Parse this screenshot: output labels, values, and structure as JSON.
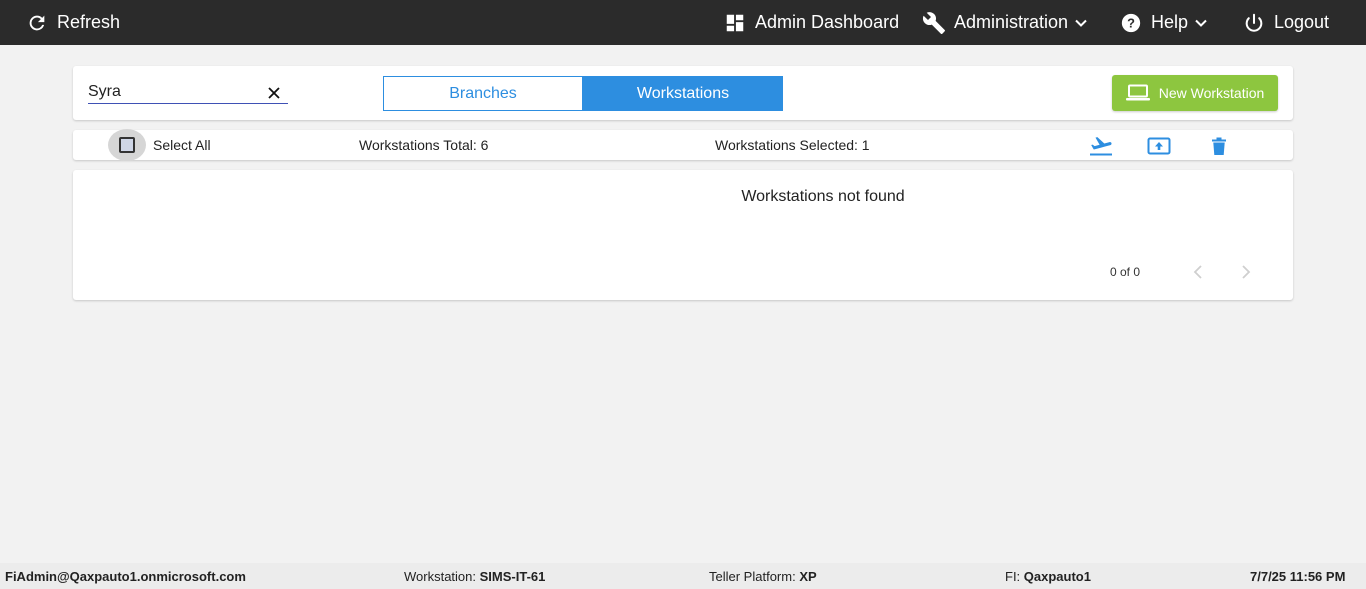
{
  "topbar": {
    "refresh_label": "Refresh",
    "dashboard_label": "Admin Dashboard",
    "administration_label": "Administration",
    "help_label": "Help",
    "logout_label": "Logout"
  },
  "search": {
    "value": "Syra",
    "placeholder": ""
  },
  "tabs": {
    "branches_label": "Branches",
    "workstations_label": "Workstations",
    "active": "Workstations"
  },
  "new_workstation_label": "New Workstation",
  "toolbar": {
    "select_all_label": "Select All",
    "total_text": "Workstations Total: 6",
    "selected_text": "Workstations Selected: 1"
  },
  "results": {
    "empty_message": "Workstations not found",
    "pager_text": "0 of 0"
  },
  "status_bar": {
    "user": "FiAdmin@Qaxpauto1.onmicrosoft.com",
    "workstation_label": "Workstation:",
    "workstation_value": "SIMS-IT-61",
    "platform_label": "Teller Platform:",
    "platform_value": "XP",
    "fi_label": "FI:",
    "fi_value": "Qaxpauto1",
    "datetime": "7/7/25 11:56 PM"
  },
  "colors": {
    "topbar_bg": "#2b2b2b",
    "accent_blue": "#2d8ee0",
    "new_button_green": "#8dc63f",
    "page_bg": "#f2f2f2"
  },
  "icons": {
    "refresh": "refresh-icon",
    "dashboard": "dashboard-icon",
    "administration": "wrench-icon",
    "help": "help-circle-icon",
    "logout": "power-icon",
    "new_workstation": "laptop-icon",
    "departure": "airplane-takeoff-icon",
    "upload": "upload-icon",
    "delete": "trash-icon"
  }
}
